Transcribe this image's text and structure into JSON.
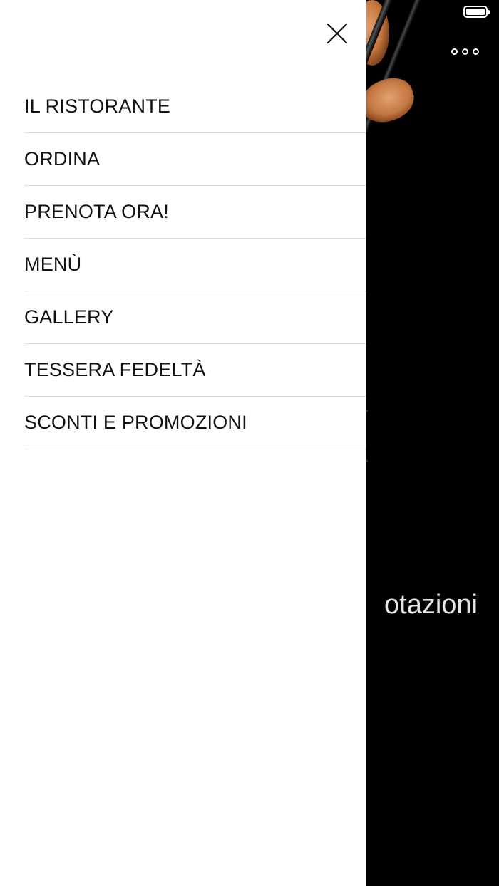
{
  "background": {
    "partial_text": "otazioni"
  },
  "drawer": {
    "items": [
      {
        "label": "IL RISTORANTE"
      },
      {
        "label": "ORDINA"
      },
      {
        "label": "PRENOTA ORA!"
      },
      {
        "label": "MENÙ"
      },
      {
        "label": "GALLERY"
      },
      {
        "label": "TESSERA FEDELTÀ"
      },
      {
        "label": "SCONTI E PROMOZIONI"
      }
    ]
  },
  "icons": {
    "close": "close-icon",
    "more": "more-options-icon",
    "battery": "battery-icon"
  },
  "colors": {
    "drawer_bg": "#ffffff",
    "app_bg": "#000000",
    "divider": "#dcdcdc",
    "text": "#111111"
  }
}
